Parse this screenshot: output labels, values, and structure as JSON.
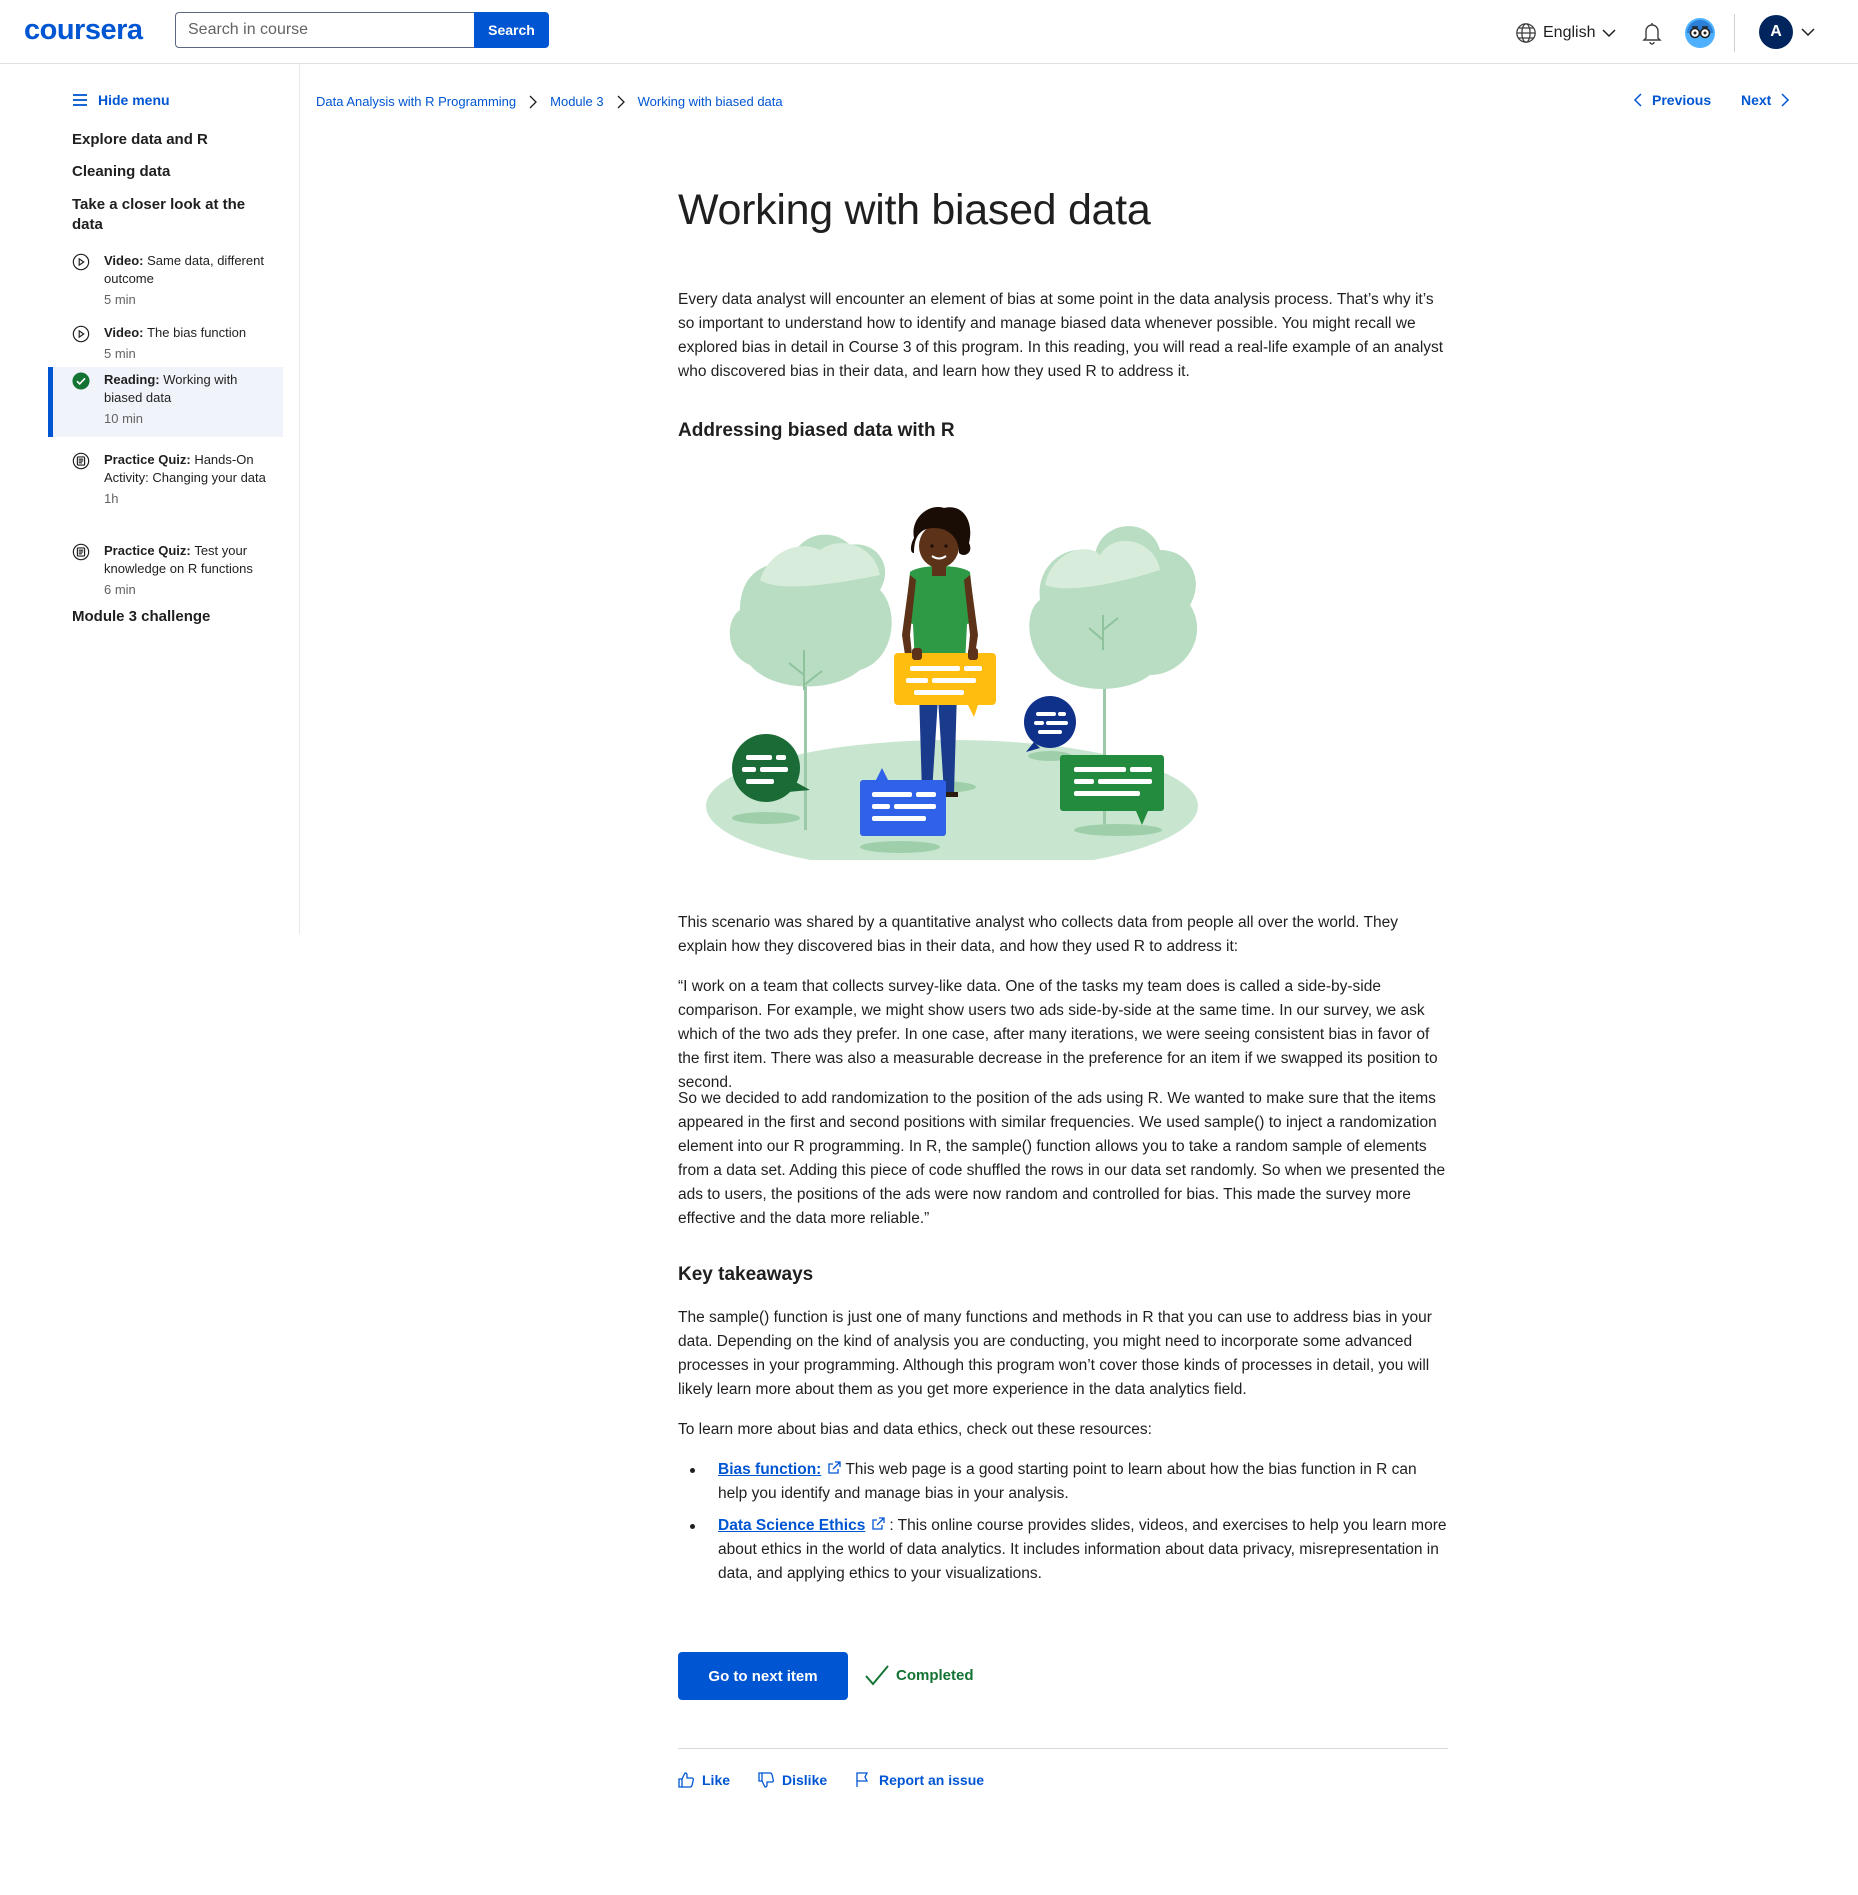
{
  "header": {
    "logo": "coursera",
    "search_placeholder": "Search in course",
    "search_button": "Search",
    "language": "English",
    "avatar_initial": "A"
  },
  "sidebar": {
    "hide_menu": "Hide menu",
    "sections": [
      "Explore data and R",
      "Cleaning data",
      "Take a closer look at the data",
      "Module 3 challenge"
    ],
    "items": [
      {
        "type": "Video:",
        "title": "Same data, different outcome",
        "duration": "5 min",
        "icon": "play-circle-icon"
      },
      {
        "type": "Video:",
        "title": "The bias function",
        "duration": "5 min",
        "icon": "play-circle-icon"
      },
      {
        "type": "Reading:",
        "title": "Working with biased data",
        "duration": "10 min",
        "icon": "check-circle-icon",
        "active": true
      },
      {
        "type": "Practice Quiz:",
        "title": "Hands-On Activity: Changing your data",
        "duration": "1h",
        "icon": "quiz-icon"
      },
      {
        "type": "Practice Quiz:",
        "title": "Test your knowledge on R functions",
        "duration": "6 min",
        "icon": "quiz-icon"
      }
    ]
  },
  "breadcrumb": [
    "Data Analysis with R Programming",
    "Module 3",
    "Working with biased data"
  ],
  "nav": {
    "previous": "Previous",
    "next": "Next"
  },
  "article": {
    "title": "Working with biased data",
    "intro": "Every data analyst will encounter an element of bias at some point in the data analysis process. That’s why it’s so important to understand how to identify and manage biased data whenever possible. You might recall we explored bias in detail in Course 3 of this program. In this reading, you will read a real-life example of an analyst who discovered bias in their data, and learn how they used R to address it.",
    "h_addressing": "Addressing biased data with R",
    "scenario": "This scenario was shared by a quantitative analyst who collects data from people all over the world. They explain how they discovered bias in their data, and how they used R to address it:",
    "quote1": "“I work on a team that collects survey-like data. One of the tasks my team does is called a side-by-side comparison. For example, we might show users two ads side-by-side at the same time. In our survey, we ask which of the two ads they prefer. In one case, after many iterations, we were seeing consistent bias in favor of the first item. There was also a measurable decrease in the preference for an item if we swapped its position to second.",
    "quote2": "So we decided to add randomization to the position of the ads using R. We wanted to make sure that the items appeared in the first and second positions with similar frequencies. We used sample() to inject a randomization element into our R programming. In R, the sample() function allows you to take a random sample of elements from a data set. Adding this piece of code shuffled the rows in our data set randomly. So when we presented the ads to users, the positions of the ads were now random and controlled for bias. This made the survey more effective and the data more reliable.”",
    "h_takeaways": "Key takeaways",
    "takeaways": "The sample() function is just one of many functions and methods in R that you can use to address bias in your data. Depending on the kind of analysis you are conducting, you might need to incorporate some advanced processes in your programming. Although this program won’t cover those kinds of processes in detail, you will likely learn more about them as you get more experience in the data analytics field.",
    "resources_intro": "To learn more about bias and data ethics, check out these resources:",
    "resources": [
      {
        "link": "Bias function:",
        "text": "This web page is a good starting point to learn about how the bias function in R can help you identify and manage bias in your analysis."
      },
      {
        "link": "Data Science Ethics",
        "text": ": This online course provides slides, videos, and exercises to help you learn more about ethics in the world of data analytics. It includes information about data privacy, misrepresentation in data, and applying ethics to your visualizations."
      }
    ]
  },
  "actions": {
    "next_item": "Go to next item",
    "completed": "Completed",
    "like": "Like",
    "dislike": "Dislike",
    "report": "Report an issue"
  },
  "colors": {
    "brand": "#0056d2",
    "success": "#137333",
    "navy": "#00255d"
  }
}
